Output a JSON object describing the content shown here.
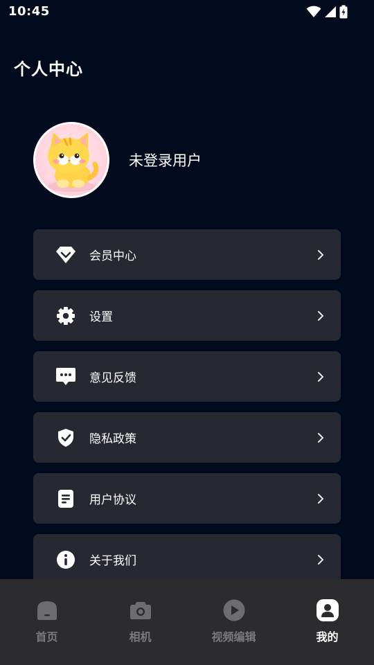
{
  "status_bar": {
    "time": "10:45"
  },
  "page": {
    "title": "个人中心"
  },
  "profile": {
    "username": "未登录用户"
  },
  "menu": {
    "items": [
      {
        "label": "会员中心",
        "icon": "diamond-icon"
      },
      {
        "label": "设置",
        "icon": "gear-icon"
      },
      {
        "label": "意见反馈",
        "icon": "feedback-chat-icon"
      },
      {
        "label": "隐私政策",
        "icon": "shield-check-icon"
      },
      {
        "label": "用户协议",
        "icon": "document-icon"
      },
      {
        "label": "关于我们",
        "icon": "info-icon"
      }
    ]
  },
  "bottom_nav": {
    "items": [
      {
        "label": "首页",
        "icon": "home-icon",
        "active": false
      },
      {
        "label": "相机",
        "icon": "camera-icon",
        "active": false
      },
      {
        "label": "视频编辑",
        "icon": "play-icon",
        "active": false
      },
      {
        "label": "我的",
        "icon": "profile-icon",
        "active": true
      }
    ]
  },
  "colors": {
    "background": "#020b1e",
    "card": "#262932",
    "nav_background": "#2c2c2f",
    "nav_inactive": "#7a7a7e",
    "nav_active": "#ffffff"
  }
}
